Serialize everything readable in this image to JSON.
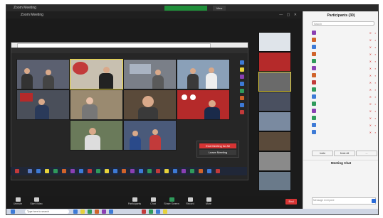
{
  "window": {
    "title": "Zoom Meeting",
    "recording_banner": "",
    "view_label": "View"
  },
  "inner_window": {
    "title": "Zoom Meeting",
    "controls": "— ▢ ✕"
  },
  "shared_screen": {
    "bar_left": "",
    "bar_right": ""
  },
  "meeting_menu": {
    "end_label": "End Meeting for All",
    "leave_label": "Leave Meeting"
  },
  "toolbar": {
    "items": [
      {
        "label": "Unmute",
        "icon": "mic-icon"
      },
      {
        "label": "Start Video",
        "icon": "video-icon"
      },
      {
        "label": "Participants",
        "icon": "participants-icon"
      },
      {
        "label": "Chat",
        "icon": "chat-icon"
      },
      {
        "label": "Share Screen",
        "icon": "share-icon"
      },
      {
        "label": "Record",
        "icon": "record-icon"
      },
      {
        "label": "More",
        "icon": "more-icon"
      }
    ],
    "end_label": "End"
  },
  "participants_panel": {
    "title": "Participants (30)",
    "search_placeholder": "Search",
    "participants": [
      {
        "name": "",
        "color": "#8a3fb3"
      },
      {
        "name": "",
        "color": "#d0632a"
      },
      {
        "name": "",
        "color": "#3d7ad6"
      },
      {
        "name": "",
        "color": "#d0632a"
      },
      {
        "name": "",
        "color": "#2f9a5b"
      },
      {
        "name": "",
        "color": "#8a3fb3"
      },
      {
        "name": "",
        "color": "#d0632a"
      },
      {
        "name": "",
        "color": "#c23a3a"
      },
      {
        "name": "",
        "color": "#2f9a5b"
      },
      {
        "name": "",
        "color": "#3d7ad6"
      },
      {
        "name": "",
        "color": "#2f9a5b"
      },
      {
        "name": "",
        "color": "#8a3fb3"
      },
      {
        "name": "",
        "color": "#2f9a5b"
      },
      {
        "name": "",
        "color": "#3d7ad6"
      },
      {
        "name": "",
        "color": "#3d7ad6"
      }
    ],
    "invite_label": "Invite",
    "mute_all_label": "Mute All",
    "more_label": "..."
  },
  "chat": {
    "title": "Meeting Chat",
    "message_1": "",
    "message_2": "",
    "input_placeholder": "Message everyone"
  },
  "taskbar": {
    "search_placeholder": "Type here to search",
    "clock": ""
  },
  "colors": {
    "accent_red": "#d63434",
    "active_border": "#e6d23a",
    "zoom_bg": "#1b1b1b"
  }
}
